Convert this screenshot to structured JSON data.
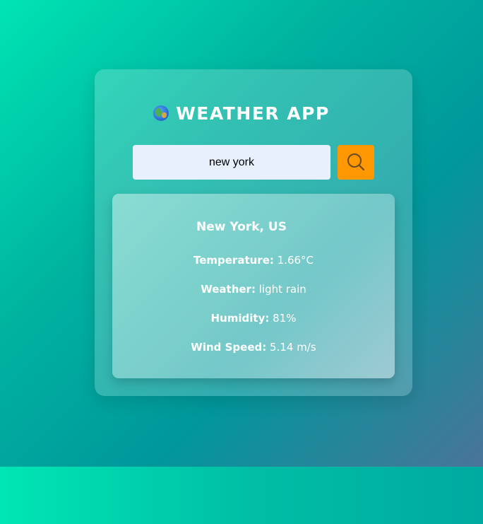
{
  "app": {
    "title": "WEATHER APP",
    "title_icon": "globe-icon"
  },
  "search": {
    "value": "new york",
    "button_icon": "search-icon",
    "button_color": "#ff9800"
  },
  "result": {
    "city": "New York, US",
    "rows": [
      {
        "label": "Temperature:",
        "value": "1.66°C"
      },
      {
        "label": "Weather:",
        "value": "light rain"
      },
      {
        "label": "Humidity:",
        "value": "81%"
      },
      {
        "label": "Wind Speed:",
        "value": "5.14 m/s"
      }
    ]
  },
  "colors": {
    "background_start": "#00e4b4",
    "background_end": "#4a7499",
    "input_background": "#e8f0fe",
    "text": "#ffffff"
  }
}
